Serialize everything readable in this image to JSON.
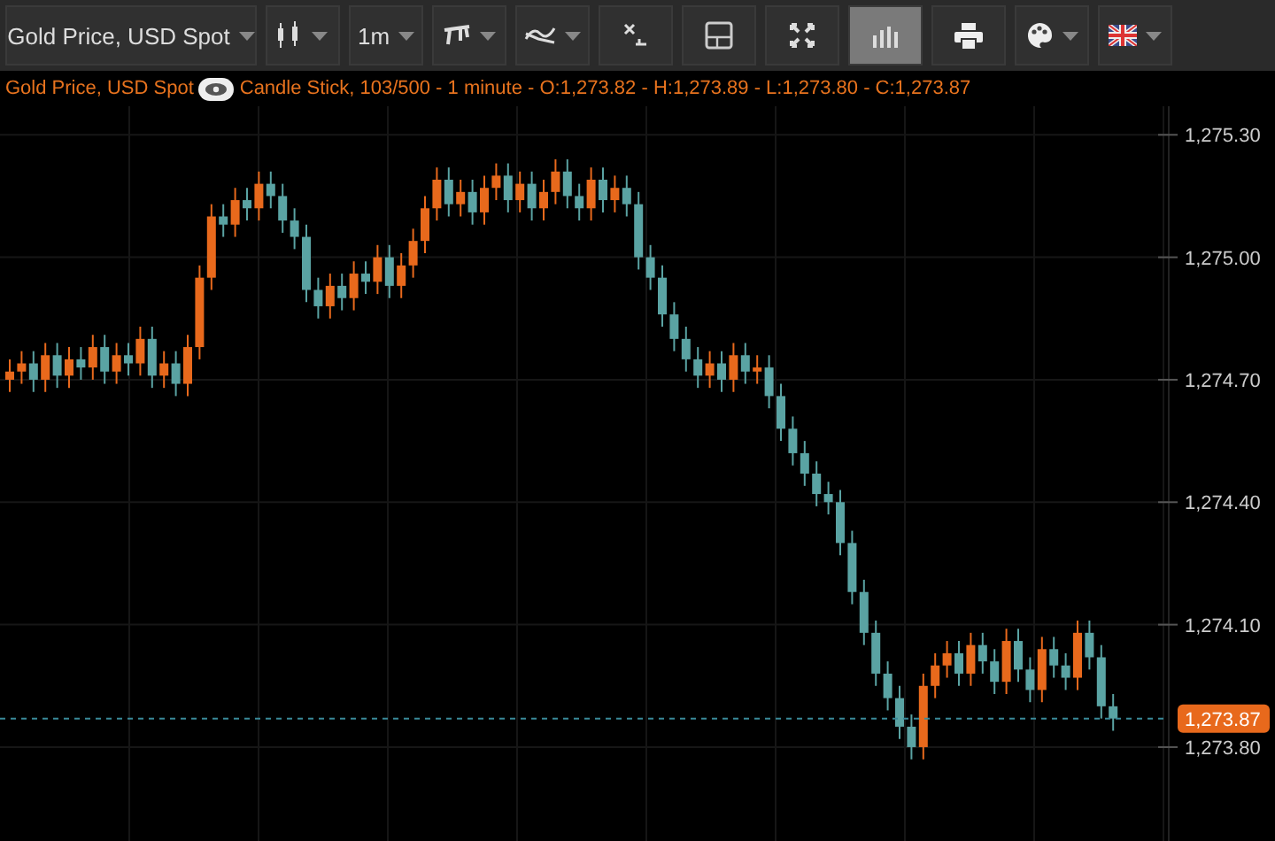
{
  "toolbar": {
    "items": [
      {
        "kind": "symbol",
        "label": "Gold Price, USD Spot",
        "dropdown": true,
        "selected": false
      },
      {
        "kind": "candles",
        "dropdown": true,
        "selected": false
      },
      {
        "kind": "interval",
        "label": "1m",
        "dropdown": true,
        "selected": false
      },
      {
        "kind": "draw",
        "dropdown": true,
        "selected": false
      },
      {
        "kind": "indicators",
        "dropdown": true,
        "selected": false
      },
      {
        "kind": "clear",
        "dropdown": false,
        "selected": false
      },
      {
        "kind": "layout",
        "dropdown": false,
        "selected": false
      },
      {
        "kind": "fullscreen",
        "dropdown": false,
        "selected": false
      },
      {
        "kind": "volume",
        "dropdown": false,
        "selected": true
      },
      {
        "kind": "print",
        "dropdown": false,
        "selected": false
      },
      {
        "kind": "palette",
        "dropdown": true,
        "selected": false
      },
      {
        "kind": "language",
        "dropdown": true,
        "selected": false
      }
    ]
  },
  "legend": {
    "symbol": "Gold Price, USD Spot",
    "details": "Candle Stick, 103/500 - 1 minute - O:1,273.82 - H:1,273.89 - L:1,273.80 - C:1,273.87"
  },
  "chart": {
    "chart_data": {
      "type": "candlestick",
      "ylim": [
        1273.57,
        1275.37
      ],
      "yticks": [
        {
          "value": 1275.3,
          "label": "1,275.30"
        },
        {
          "value": 1275.0,
          "label": "1,275.00"
        },
        {
          "value": 1274.7,
          "label": "1,274.70"
        },
        {
          "value": 1274.4,
          "label": "1,274.40"
        },
        {
          "value": 1274.1,
          "label": "1,274.10"
        },
        {
          "value": 1273.8,
          "label": "1,273.80"
        }
      ],
      "grid": true,
      "ref_lines": [
        {
          "axis": "y",
          "value": 1273.87,
          "label": "1,273.87",
          "color": "#3a8a9a"
        }
      ],
      "ohlc": [
        [
          1274.7,
          1274.75,
          1274.67,
          1274.72
        ],
        [
          1274.72,
          1274.77,
          1274.69,
          1274.74
        ],
        [
          1274.74,
          1274.77,
          1274.67,
          1274.7
        ],
        [
          1274.7,
          1274.79,
          1274.67,
          1274.76
        ],
        [
          1274.76,
          1274.79,
          1274.68,
          1274.71
        ],
        [
          1274.71,
          1274.78,
          1274.68,
          1274.75
        ],
        [
          1274.75,
          1274.78,
          1274.7,
          1274.73
        ],
        [
          1274.73,
          1274.81,
          1274.7,
          1274.78
        ],
        [
          1274.78,
          1274.81,
          1274.69,
          1274.72
        ],
        [
          1274.72,
          1274.79,
          1274.69,
          1274.76
        ],
        [
          1274.76,
          1274.79,
          1274.71,
          1274.74
        ],
        [
          1274.74,
          1274.83,
          1274.71,
          1274.8
        ],
        [
          1274.8,
          1274.83,
          1274.68,
          1274.71
        ],
        [
          1274.71,
          1274.77,
          1274.68,
          1274.74
        ],
        [
          1274.74,
          1274.77,
          1274.66,
          1274.69
        ],
        [
          1274.69,
          1274.81,
          1274.66,
          1274.78
        ],
        [
          1274.78,
          1274.98,
          1274.75,
          1274.95
        ],
        [
          1274.95,
          1275.13,
          1274.92,
          1275.1
        ],
        [
          1275.1,
          1275.13,
          1275.05,
          1275.08
        ],
        [
          1275.08,
          1275.17,
          1275.05,
          1275.14
        ],
        [
          1275.14,
          1275.17,
          1275.09,
          1275.12
        ],
        [
          1275.12,
          1275.21,
          1275.09,
          1275.18
        ],
        [
          1275.18,
          1275.21,
          1275.12,
          1275.15
        ],
        [
          1275.15,
          1275.18,
          1275.06,
          1275.09
        ],
        [
          1275.09,
          1275.12,
          1275.02,
          1275.05
        ],
        [
          1275.05,
          1275.08,
          1274.89,
          1274.92
        ],
        [
          1274.92,
          1274.95,
          1274.85,
          1274.88
        ],
        [
          1274.88,
          1274.96,
          1274.85,
          1274.93
        ],
        [
          1274.93,
          1274.96,
          1274.87,
          1274.9
        ],
        [
          1274.9,
          1274.99,
          1274.87,
          1274.96
        ],
        [
          1274.96,
          1274.99,
          1274.91,
          1274.94
        ],
        [
          1274.94,
          1275.03,
          1274.91,
          1275.0
        ],
        [
          1275.0,
          1275.03,
          1274.9,
          1274.93
        ],
        [
          1274.93,
          1275.01,
          1274.9,
          1274.98
        ],
        [
          1274.98,
          1275.07,
          1274.95,
          1275.04
        ],
        [
          1275.04,
          1275.15,
          1275.01,
          1275.12
        ],
        [
          1275.12,
          1275.22,
          1275.09,
          1275.19
        ],
        [
          1275.19,
          1275.22,
          1275.1,
          1275.13
        ],
        [
          1275.13,
          1275.19,
          1275.1,
          1275.16
        ],
        [
          1275.16,
          1275.19,
          1275.08,
          1275.11
        ],
        [
          1275.11,
          1275.2,
          1275.08,
          1275.17
        ],
        [
          1275.17,
          1275.23,
          1275.14,
          1275.2
        ],
        [
          1275.2,
          1275.23,
          1275.11,
          1275.14
        ],
        [
          1275.14,
          1275.21,
          1275.11,
          1275.18
        ],
        [
          1275.18,
          1275.21,
          1275.09,
          1275.12
        ],
        [
          1275.12,
          1275.19,
          1275.09,
          1275.16
        ],
        [
          1275.16,
          1275.24,
          1275.13,
          1275.21
        ],
        [
          1275.21,
          1275.24,
          1275.12,
          1275.15
        ],
        [
          1275.15,
          1275.18,
          1275.09,
          1275.12
        ],
        [
          1275.12,
          1275.22,
          1275.09,
          1275.19
        ],
        [
          1275.19,
          1275.22,
          1275.11,
          1275.14
        ],
        [
          1275.14,
          1275.2,
          1275.11,
          1275.17
        ],
        [
          1275.17,
          1275.2,
          1275.1,
          1275.13
        ],
        [
          1275.13,
          1275.16,
          1274.97,
          1275.0
        ],
        [
          1275.0,
          1275.03,
          1274.92,
          1274.95
        ],
        [
          1274.95,
          1274.98,
          1274.83,
          1274.86
        ],
        [
          1274.86,
          1274.89,
          1274.77,
          1274.8
        ],
        [
          1274.8,
          1274.83,
          1274.72,
          1274.75
        ],
        [
          1274.75,
          1274.78,
          1274.68,
          1274.71
        ],
        [
          1274.71,
          1274.77,
          1274.68,
          1274.74
        ],
        [
          1274.74,
          1274.77,
          1274.67,
          1274.7
        ],
        [
          1274.7,
          1274.79,
          1274.67,
          1274.76
        ],
        [
          1274.76,
          1274.79,
          1274.69,
          1274.72
        ],
        [
          1274.72,
          1274.76,
          1274.69,
          1274.73
        ],
        [
          1274.73,
          1274.76,
          1274.63,
          1274.66
        ],
        [
          1274.66,
          1274.69,
          1274.55,
          1274.58
        ],
        [
          1274.58,
          1274.61,
          1274.49,
          1274.52
        ],
        [
          1274.52,
          1274.55,
          1274.44,
          1274.47
        ],
        [
          1274.47,
          1274.5,
          1274.39,
          1274.42
        ],
        [
          1274.42,
          1274.45,
          1274.37,
          1274.4
        ],
        [
          1274.4,
          1274.43,
          1274.27,
          1274.3
        ],
        [
          1274.3,
          1274.33,
          1274.15,
          1274.18
        ],
        [
          1274.18,
          1274.21,
          1274.05,
          1274.08
        ],
        [
          1274.08,
          1274.11,
          1273.95,
          1273.98
        ],
        [
          1273.98,
          1274.01,
          1273.89,
          1273.92
        ],
        [
          1273.92,
          1273.95,
          1273.82,
          1273.85
        ],
        [
          1273.85,
          1273.88,
          1273.77,
          1273.8
        ],
        [
          1273.8,
          1273.98,
          1273.77,
          1273.95
        ],
        [
          1273.95,
          1274.03,
          1273.92,
          1274.0
        ],
        [
          1274.0,
          1274.06,
          1273.97,
          1274.03
        ],
        [
          1274.03,
          1274.06,
          1273.95,
          1273.98
        ],
        [
          1273.98,
          1274.08,
          1273.95,
          1274.05
        ],
        [
          1274.05,
          1274.08,
          1273.98,
          1274.01
        ],
        [
          1274.01,
          1274.04,
          1273.93,
          1273.96
        ],
        [
          1273.96,
          1274.09,
          1273.93,
          1274.06
        ],
        [
          1274.06,
          1274.09,
          1273.96,
          1273.99
        ],
        [
          1273.99,
          1274.02,
          1273.91,
          1273.94
        ],
        [
          1273.94,
          1274.07,
          1273.91,
          1274.04
        ],
        [
          1274.04,
          1274.07,
          1273.97,
          1274.0
        ],
        [
          1274.0,
          1274.03,
          1273.94,
          1273.97
        ],
        [
          1273.97,
          1274.11,
          1273.94,
          1274.08
        ],
        [
          1274.08,
          1274.11,
          1273.99,
          1274.02
        ],
        [
          1274.02,
          1274.05,
          1273.87,
          1273.9
        ],
        [
          1273.9,
          1273.93,
          1273.84,
          1273.87
        ]
      ]
    }
  }
}
